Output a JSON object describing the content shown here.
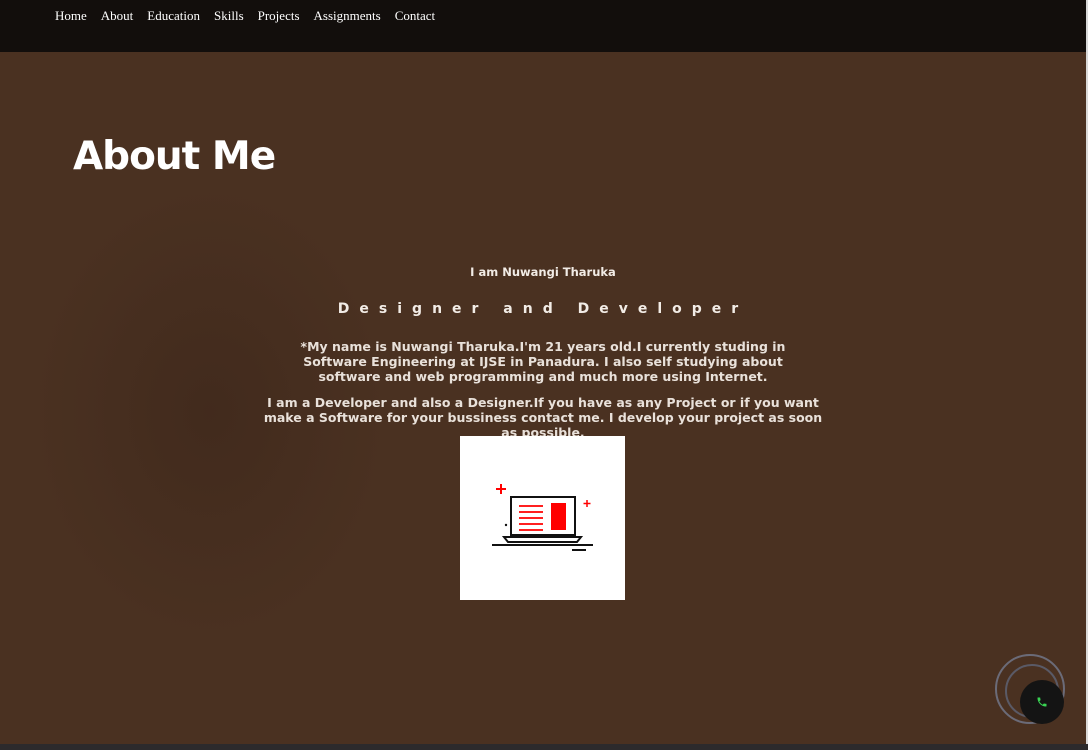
{
  "nav": {
    "items": [
      {
        "label": "Home"
      },
      {
        "label": "About"
      },
      {
        "label": "Education"
      },
      {
        "label": "Skills"
      },
      {
        "label": "Projects"
      },
      {
        "label": "Assignments"
      },
      {
        "label": "Contact"
      }
    ]
  },
  "about": {
    "title": "About Me",
    "intro": "I am Nuwangi Tharuka",
    "role": "Designer and Developer",
    "paragraph1": "*My name is Nuwangi Tharuka.I'm 21 years old.I currently studing in Software Engineering at IJSE in Panadura. I also self studying about software and web programming and much more using Internet.",
    "paragraph2": "I am a Developer and also a Designer.If you have as any Project or if you want make a Software for your bussiness contact me. I develop your project as soon as possible.",
    "illustration_icon": "laptop-document-icon"
  },
  "call_button": {
    "icon": "phone-icon",
    "icon_color": "#39d353"
  },
  "colors": {
    "navbar": "#120e0c",
    "background": "#4a3121",
    "accent_red": "#ff0000",
    "text": "#ffffff"
  }
}
